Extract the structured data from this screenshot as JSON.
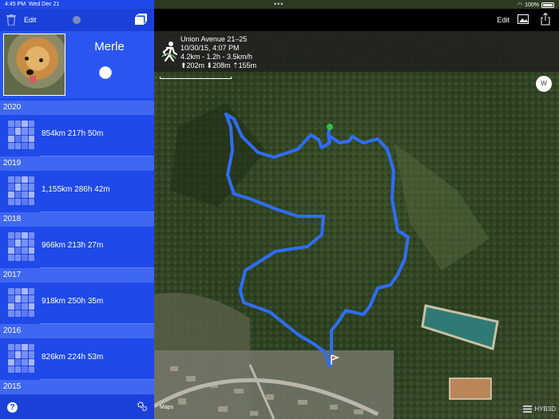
{
  "status_bar": {
    "time": "4:45 PM",
    "date": "Wed Dec 21",
    "battery": "100%"
  },
  "sidebar": {
    "toolbar": {
      "edit_label": "Edit"
    },
    "profile": {
      "name": "Merle"
    },
    "years": [
      {
        "year": "2020",
        "stats": "854km 217h 50m"
      },
      {
        "year": "2019",
        "stats": "1,155km 286h 42m"
      },
      {
        "year": "2018",
        "stats": "966km 213h 27m"
      },
      {
        "year": "2017",
        "stats": "918km 250h 35m"
      },
      {
        "year": "2016",
        "stats": "826km 224h 53m"
      },
      {
        "year": "2015",
        "stats": ""
      }
    ],
    "help_label": "?"
  },
  "main": {
    "toolbar": {
      "edit_label": "Edit"
    },
    "track": {
      "title": "Union Avenue 21–25",
      "datetime": "10/30/15, 4:07 PM",
      "summary": "4.2km - 1.2h - 3.5km/h",
      "elevation": "⬆202m  ⬇208m  ⇡155m"
    },
    "compass_label": "W",
    "maps_legal": "Maps",
    "map_type_label": "HYB3D",
    "accent": "#1f49e9",
    "route_color": "#2f6df5"
  },
  "icons": [
    "trash-icon",
    "stack-icon",
    "help-icon",
    "gear-icon",
    "photo-icon",
    "share-icon",
    "hiker-icon",
    "compass-icon",
    "map-layers-icon"
  ]
}
